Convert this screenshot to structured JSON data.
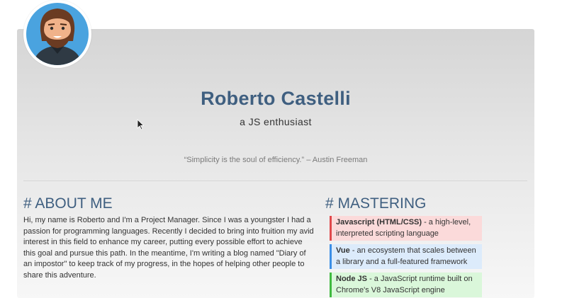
{
  "profile": {
    "name": "Roberto Castelli",
    "tagline": "a JS enthusiast",
    "quote": "“Simplicity is the soul of efficiency.” – Austin Freeman"
  },
  "about": {
    "title": "# ABOUT ME",
    "text": "Hi, my name is Roberto and I'm a Project Manager. Since I was a youngster I had a passion for programming languages. Recently I decided to bring into fruition my avid interest in this field to enhance my career, putting every possible effort to achieve this goal and pursue this path. In the meantime, I'm writing a blog named \"Diary of an impostor\" to keep track of my progress, in the hopes of helping other people to share this adventure."
  },
  "mastering": {
    "title": "# MASTERING",
    "skills": [
      {
        "name": "Javascript (HTML/CSS)",
        "desc": " - a high-level, interpreted scripting language",
        "color": "#e0484b",
        "bg": "#fbdada"
      },
      {
        "name": "Vue",
        "desc": " - an ecosystem that scales between a library and a full-featured framework",
        "color": "#3a8ee6",
        "bg": "#dcebfb"
      },
      {
        "name": "Node JS",
        "desc": " - a JavaScript runtime built on Chrome's V8 JavaScript engine",
        "color": "#3fba3f",
        "bg": "#daf7da"
      }
    ]
  },
  "icons": {
    "avatar": "bearded-man-avatar",
    "cursor": "mouse-pointer-icon"
  }
}
